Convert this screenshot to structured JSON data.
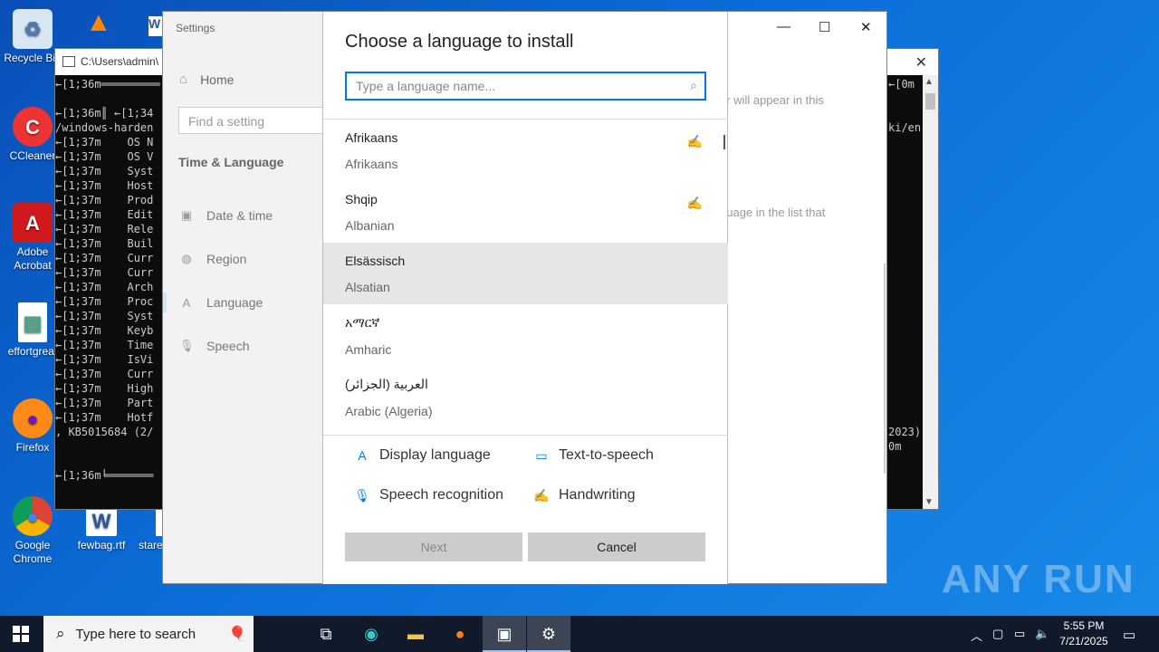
{
  "desktop": {
    "icons": [
      {
        "label": "Recycle Bin",
        "icon": "recycle-bin-icon"
      },
      {
        "label": "CCleaner",
        "icon": "ccleaner-icon"
      },
      {
        "label": "Adobe Acrobat",
        "icon": "adobe-acrobat-icon"
      },
      {
        "label": "effortgreat",
        "icon": "image-file-icon"
      },
      {
        "label": "Firefox",
        "icon": "firefox-icon"
      },
      {
        "label": "Google Chrome",
        "icon": "chrome-icon"
      },
      {
        "label": "fewbag.rtf",
        "icon": "word-doc-icon"
      },
      {
        "label": "stare",
        "icon": "file-icon"
      }
    ],
    "watermark": "ANY RUN"
  },
  "console": {
    "title": "C:\\Users\\admin\\",
    "lines": [
      "←[1;36m═════════",
      "",
      "←[1;36m║ ←[1;34",
      "/windows-harden",
      "←[1;37m    OS N",
      "←[1;37m    OS V",
      "←[1;37m    Syst",
      "←[1;37m    Host",
      "←[1;37m    Prod",
      "←[1;37m    Edit",
      "←[1;37m    Rele",
      "←[1;37m    Buil",
      "←[1;37m    Curr",
      "←[1;37m    Curr",
      "←[1;37m    Arch",
      "←[1;37m    Proc",
      "←[1;37m    Syst",
      "←[1;37m    Keyb",
      "←[1;37m    Time",
      "←[1;37m    IsVi",
      "←[1;37m    Curr",
      "←[1;37m    High",
      "←[1;37m    Part",
      "←[1;37m    Hotf",
      ", KB5015684 (2/",
      "",
      "",
      "←[1;36m╘═══════"
    ],
    "right_top": [
      "←[0m",
      "",
      "",
      "ki/en"
    ],
    "right_bottom": [
      "2023)",
      "0m"
    ]
  },
  "settings": {
    "app_title": "Settings",
    "home": "Home",
    "find_placeholder": "Find a setting",
    "section": "Time & Language",
    "nav": [
      {
        "label": "Date & time",
        "icon": "calendar-clock-icon"
      },
      {
        "label": "Region",
        "icon": "globe-icon"
      },
      {
        "label": "Language",
        "icon": "language-icon"
      },
      {
        "label": "Speech",
        "icon": "microphone-icon"
      }
    ],
    "bg_text_1": "er will appear in this",
    "bg_text_2": "guage in the list that"
  },
  "dialog": {
    "title": "Choose a language to install",
    "search_placeholder": "Type a language name...",
    "languages": [
      {
        "native": "Afrikaans",
        "english": "Afrikaans",
        "handwriting": true,
        "selected": false
      },
      {
        "native": "Shqip",
        "english": "Albanian",
        "handwriting": true,
        "selected": false
      },
      {
        "native": "Elsässisch",
        "english": "Alsatian",
        "handwriting": false,
        "selected": true
      },
      {
        "native": "አማርኛ",
        "english": "Amharic",
        "handwriting": false,
        "selected": false
      },
      {
        "native": "العربية (الجزائر)",
        "english": "Arabic (Algeria)",
        "handwriting": false,
        "selected": false
      }
    ],
    "features": {
      "display_language": "Display language",
      "text_to_speech": "Text-to-speech",
      "speech_recognition": "Speech recognition",
      "handwriting": "Handwriting"
    },
    "next_label": "Next",
    "cancel_label": "Cancel"
  },
  "taskbar": {
    "search_placeholder": "Type here to search",
    "time": "5:55 PM",
    "date": "7/21/2025"
  }
}
